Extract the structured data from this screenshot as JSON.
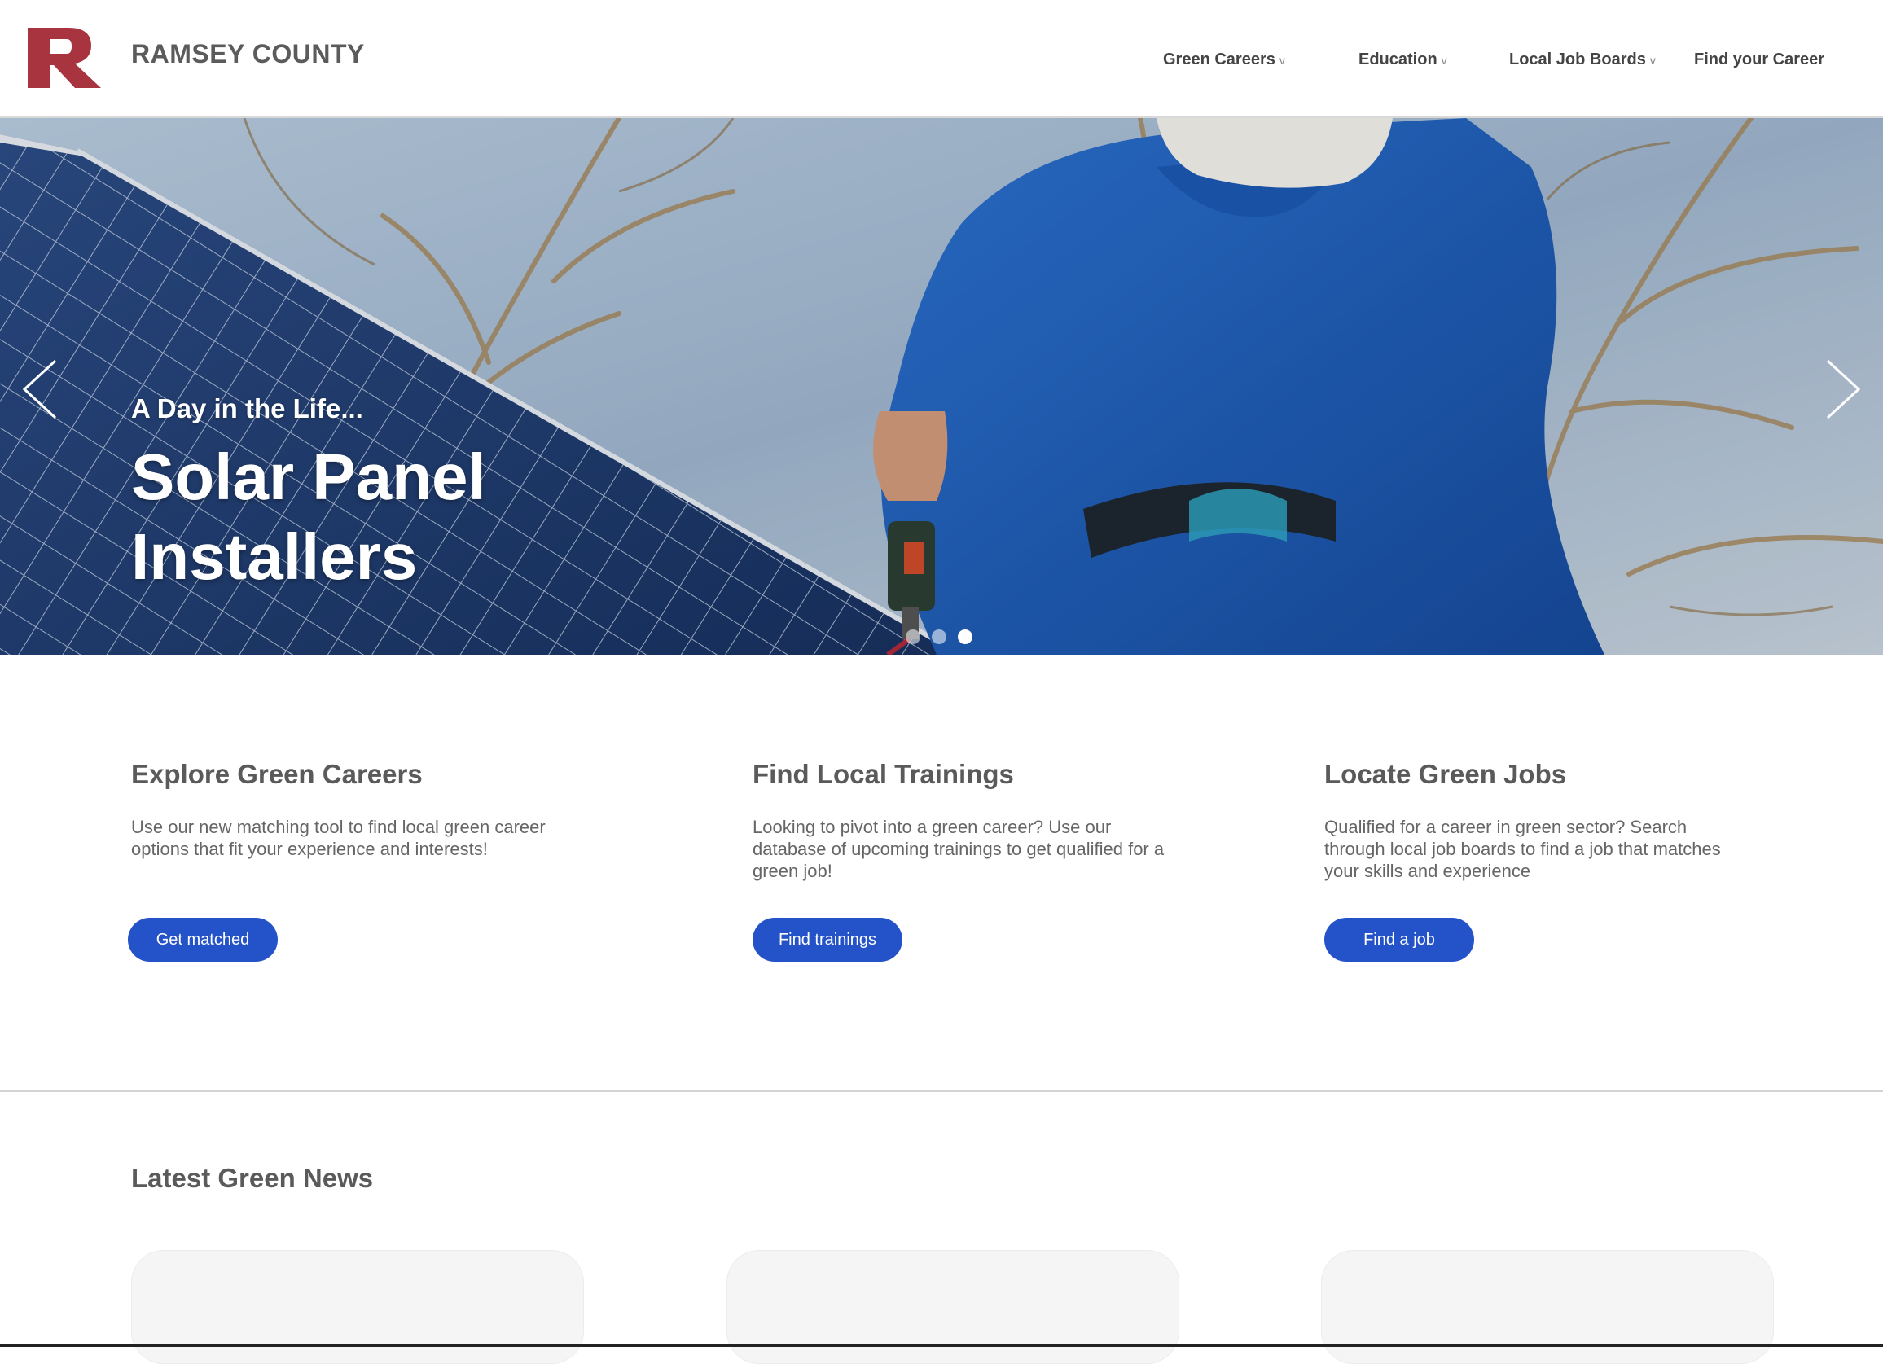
{
  "header": {
    "brand": "RAMSEY COUNTY",
    "logo_color": "#a8343f",
    "nav": [
      {
        "label": "Green Careers",
        "chevron": "v"
      },
      {
        "label": "Education",
        "chevron": "v"
      },
      {
        "label": "Local Job Boards",
        "chevron": "v"
      },
      {
        "label": "Find your Career"
      }
    ]
  },
  "hero": {
    "kicker": "A Day in the Life...",
    "title": "Solar Panel Installers",
    "prev_icon": "chevron-left-icon",
    "next_icon": "chevron-right-icon",
    "slide_count": 3,
    "active_slide": 3
  },
  "features": [
    {
      "title": "Explore Green Careers",
      "body": "Use our new matching tool to find local green career options that fit your experience and interests!",
      "button": "Get matched"
    },
    {
      "title": "Find Local Trainings",
      "body": "Looking to pivot into a green career? Use our database of upcoming trainings to get qualified for a green job!",
      "button": "Find trainings"
    },
    {
      "title": "Locate Green Jobs",
      "body": "Qualified for a career in green sector? Search through local job boards to find a job that matches your skills and experience",
      "button": "Find a job"
    }
  ],
  "news": {
    "title": "Latest Green News"
  },
  "colors": {
    "accent": "#2452c9",
    "brand_red": "#a8343f",
    "heading_text": "#5a5a5a"
  }
}
